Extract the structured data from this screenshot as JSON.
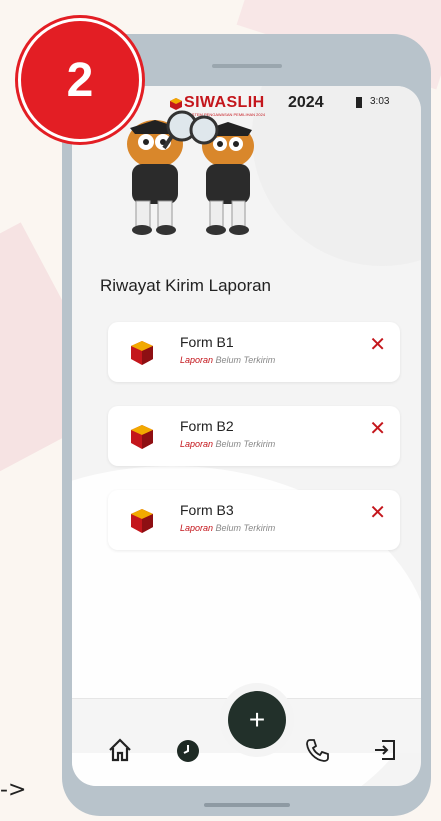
{
  "step_badge": "2",
  "arrow": "->",
  "status_bar": {
    "app_name": "SIWASLIH",
    "app_subtitle": "SISTEM PENGAWASAN PEMILIHAN 2024",
    "year": "2024",
    "time": "3:03"
  },
  "page": {
    "title": "Riwayat Kirim Laporan"
  },
  "reports": [
    {
      "name": "Form B1",
      "status_part1": "Laporan",
      "status_part2": " Belum ",
      "status_part3": "Terkirim"
    },
    {
      "name": "Form B2",
      "status_part1": "Laporan",
      "status_part2": " Belum ",
      "status_part3": "Terkirim"
    },
    {
      "name": "Form B3",
      "status_part1": "Laporan",
      "status_part2": " Belum ",
      "status_part3": "Terkirim"
    }
  ],
  "icons": {
    "delete": "close-icon",
    "home": "home-icon",
    "history": "clock-icon",
    "add": "plus-icon",
    "call": "phone-icon",
    "logout": "logout-icon",
    "report": "ballot-box-icon"
  },
  "colors": {
    "brand_red": "#c4161c",
    "badge_red": "#e31e24",
    "fab": "#22302a"
  }
}
